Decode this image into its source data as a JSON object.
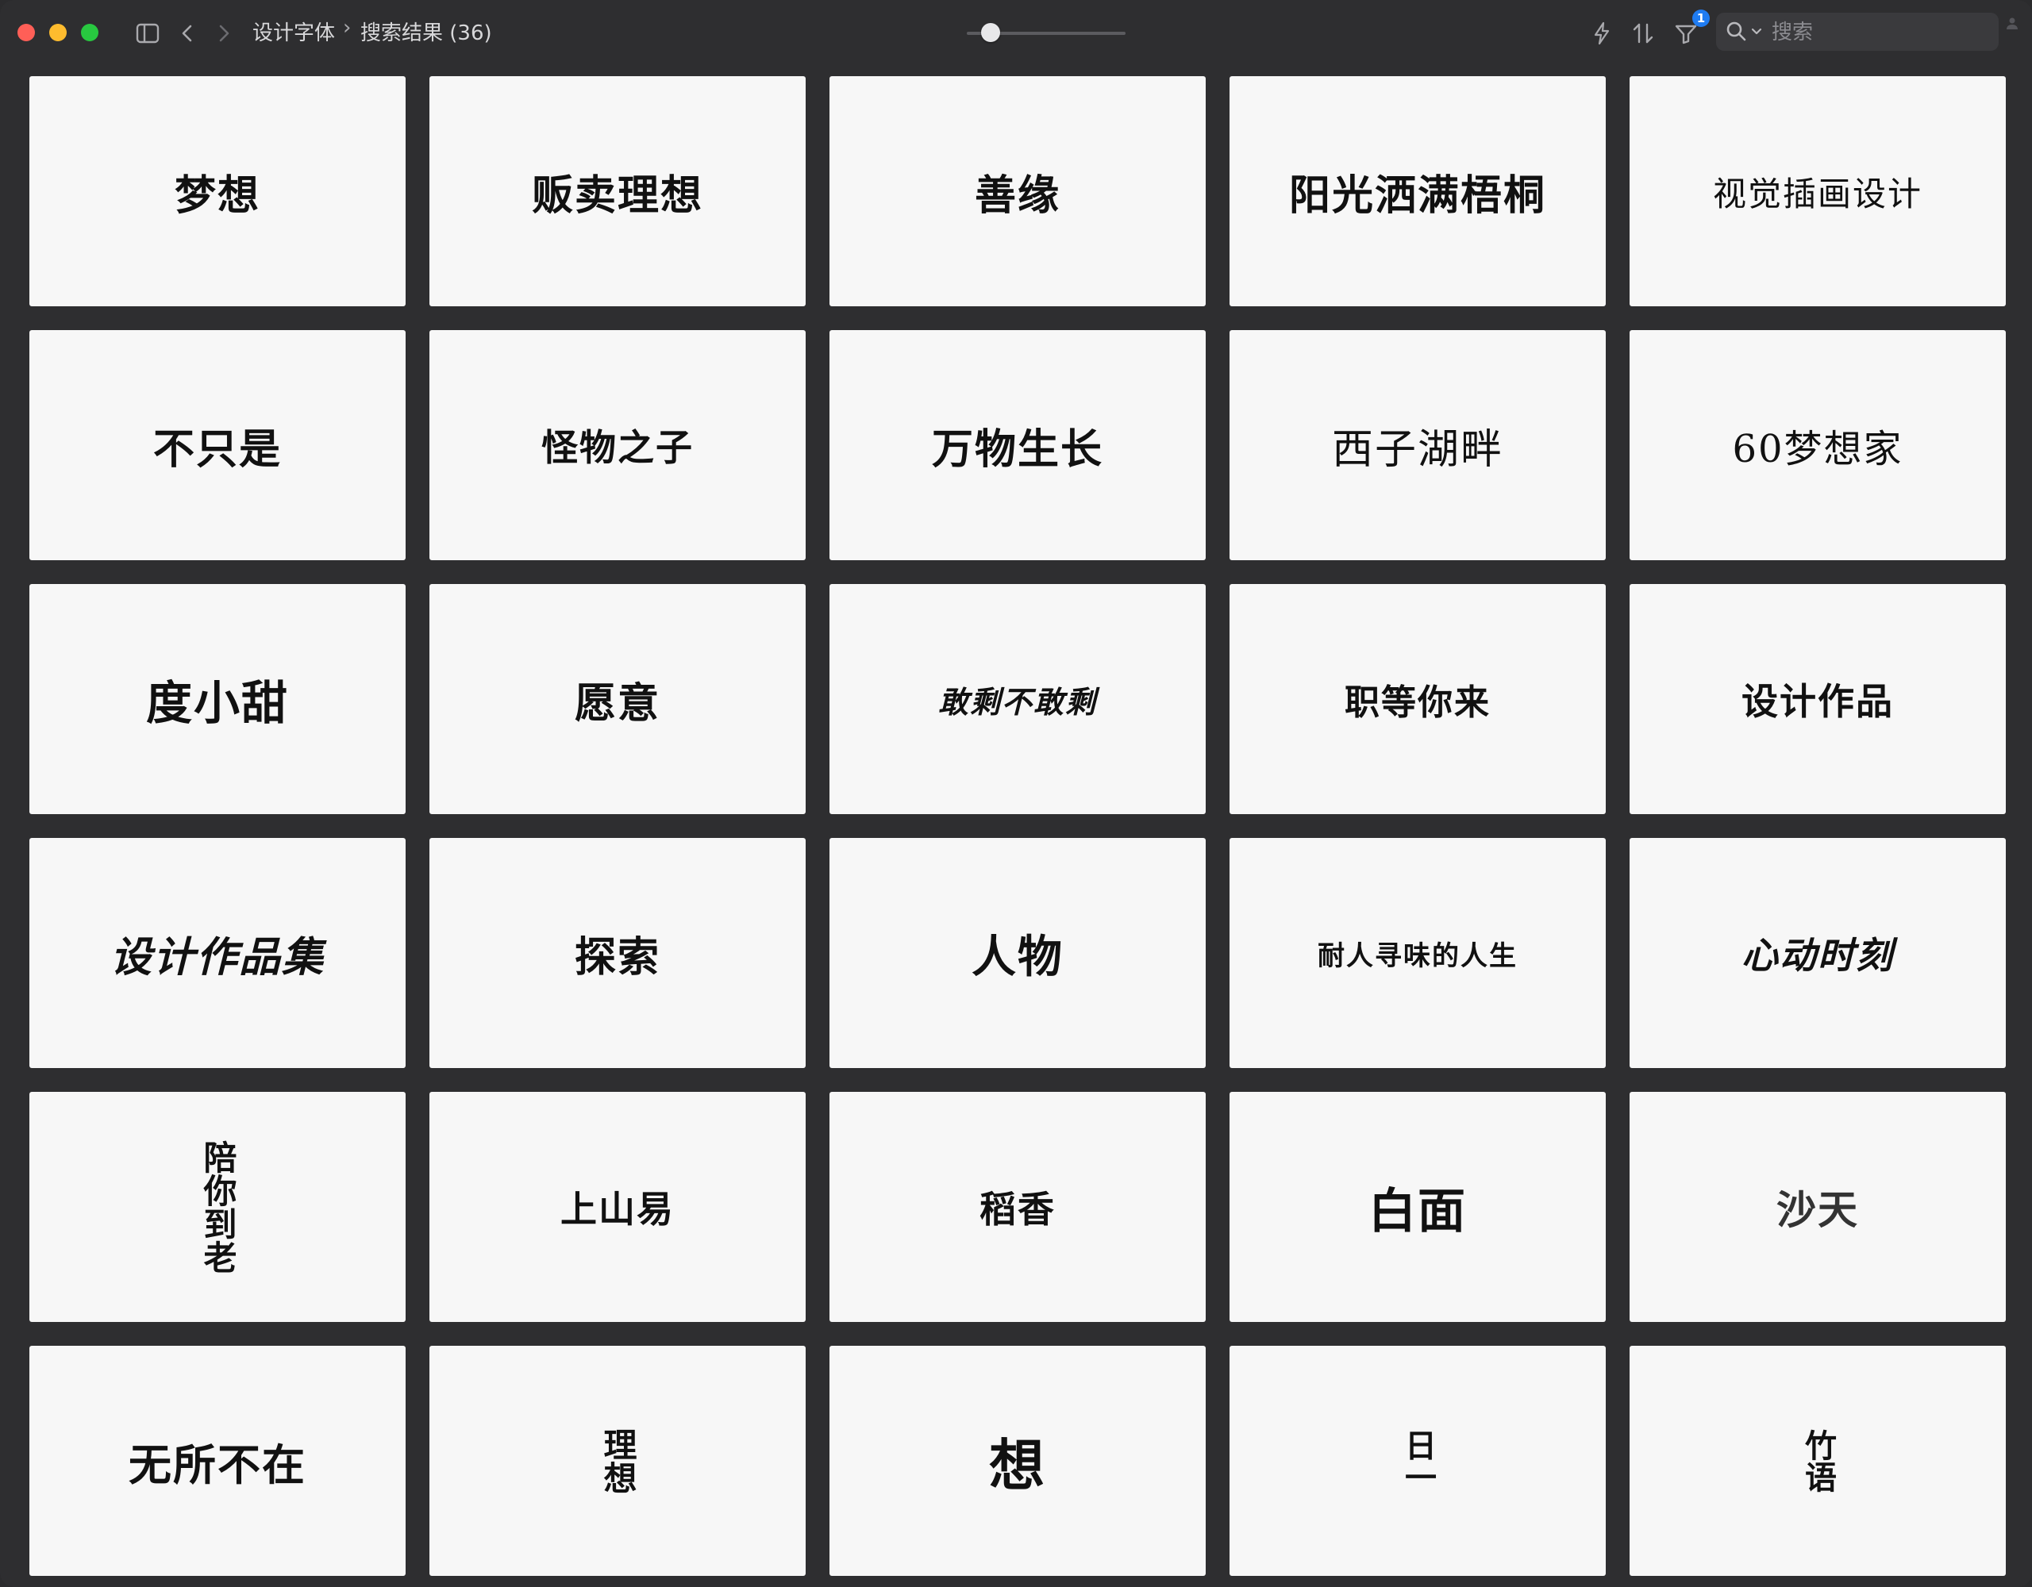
{
  "toolbar": {
    "breadcrumb_folder": "设计字体",
    "breadcrumb_current": "搜索结果 (36)",
    "filter_badge": "1",
    "search_placeholder": "搜索",
    "icons": [
      "sidebar-toggle-icon",
      "back-icon",
      "forward-icon",
      "lightning-icon",
      "sort-icon",
      "filter-icon",
      "search-icon",
      "chevron-down-icon"
    ]
  },
  "colors": {
    "close": "#ff5f57",
    "minimize": "#febc2e",
    "zoom": "#28c840",
    "badge": "#1f7cf2",
    "background": "#2e2e30",
    "tile": "#f7f7f7"
  },
  "grid": {
    "items": [
      {
        "text": "梦想"
      },
      {
        "text": "贩卖理想"
      },
      {
        "text": "善缘"
      },
      {
        "text": "阳光洒满梧桐"
      },
      {
        "text": "视觉插画设计"
      },
      {
        "text": "不只是"
      },
      {
        "text": "怪物之子"
      },
      {
        "text": "万物生长"
      },
      {
        "text": "西子湖畔"
      },
      {
        "text": "60梦想家"
      },
      {
        "text": "度小甜"
      },
      {
        "text": "愿意"
      },
      {
        "text": "敢剩不敢剩"
      },
      {
        "text": "职等你来"
      },
      {
        "text": "设计作品"
      },
      {
        "text": "设计作品集"
      },
      {
        "text": "探索"
      },
      {
        "text": "人物"
      },
      {
        "text": "耐人寻味的人生"
      },
      {
        "text": "心动时刻"
      },
      {
        "text": "陪你到老"
      },
      {
        "text": "上山易"
      },
      {
        "text": "稻香"
      },
      {
        "text": "白面"
      },
      {
        "text": "沙天"
      },
      {
        "text": "无所不在"
      },
      {
        "text": "理想"
      },
      {
        "text": "想"
      },
      {
        "text": "日一"
      },
      {
        "text": "竹语"
      }
    ]
  }
}
